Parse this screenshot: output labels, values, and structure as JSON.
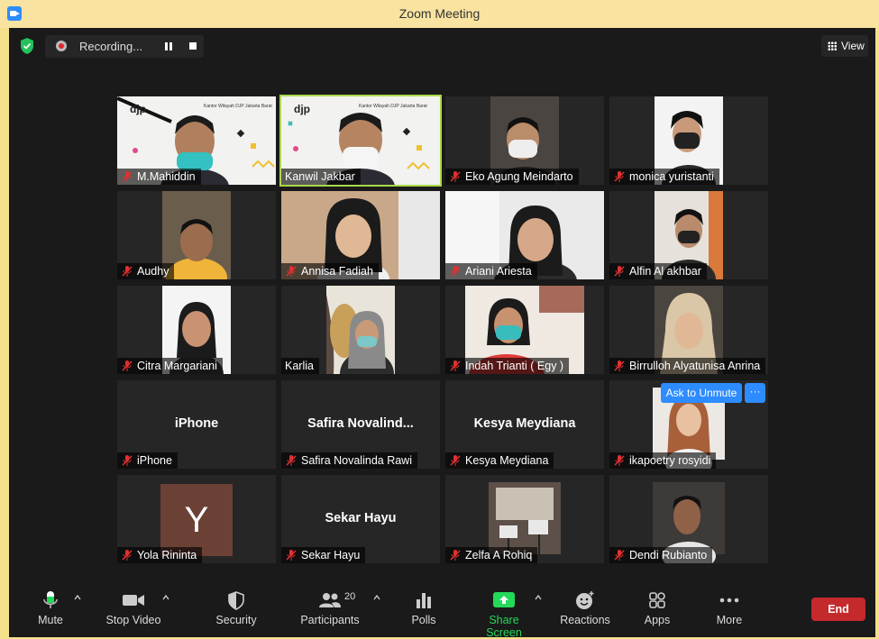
{
  "window": {
    "title": "Zoom Meeting"
  },
  "recording": {
    "label": "Recording..."
  },
  "view": {
    "label": "View"
  },
  "participants_grid": [
    {
      "name": "M.Mahiddin",
      "muted": true
    },
    {
      "name": "Kanwil Jakbar",
      "muted": false,
      "active_speaker": true
    },
    {
      "name": "Eko Agung Meindarto",
      "muted": true
    },
    {
      "name": "monica yuristanti",
      "muted": true
    },
    {
      "name": "Audhy",
      "muted": true
    },
    {
      "name": "Annisa Fadiah",
      "muted": true
    },
    {
      "name": "Ariani Ariesta",
      "muted": true
    },
    {
      "name": "Alfin Al akhbar",
      "muted": true
    },
    {
      "name": "Citra Margariani",
      "muted": true
    },
    {
      "name": "Karlia",
      "muted": false
    },
    {
      "name": "Indah Trianti ( Egy )",
      "muted": true
    },
    {
      "name": "Birrulloh Alyatunisa Anrina",
      "muted": true
    },
    {
      "name": "iPhone",
      "muted": true,
      "display": "iPhone"
    },
    {
      "name": "Safira Novalinda Rawi",
      "muted": true,
      "display": "Safira  Novalind..."
    },
    {
      "name": "Kesya Meydiana",
      "muted": true,
      "display": "Kesya Meydiana"
    },
    {
      "name": "ikapoetry rosyidi",
      "muted": true
    },
    {
      "name": "Yola Rininta",
      "muted": true,
      "avatar_letter": "Y"
    },
    {
      "name": "Sekar Hayu",
      "muted": true,
      "display": "Sekar Hayu"
    },
    {
      "name": "Zelfa A Rohiq",
      "muted": true
    },
    {
      "name": "Dendi Rubianto",
      "muted": true
    }
  ],
  "ask_to_unmute": {
    "label": "Ask to Unmute",
    "more": "···"
  },
  "toolbar": {
    "mute": "Mute",
    "stop_video": "Stop Video",
    "security": "Security",
    "participants": "Participants",
    "participants_count": "20",
    "polls": "Polls",
    "share_screen": "Share Screen",
    "reactions": "Reactions",
    "apps": "Apps",
    "more": "More",
    "end": "End"
  },
  "colors": {
    "accent": "#2d8cff",
    "share_green": "#23d959",
    "end_red": "#c4292c",
    "speaker_outline": "#a8d84a"
  }
}
